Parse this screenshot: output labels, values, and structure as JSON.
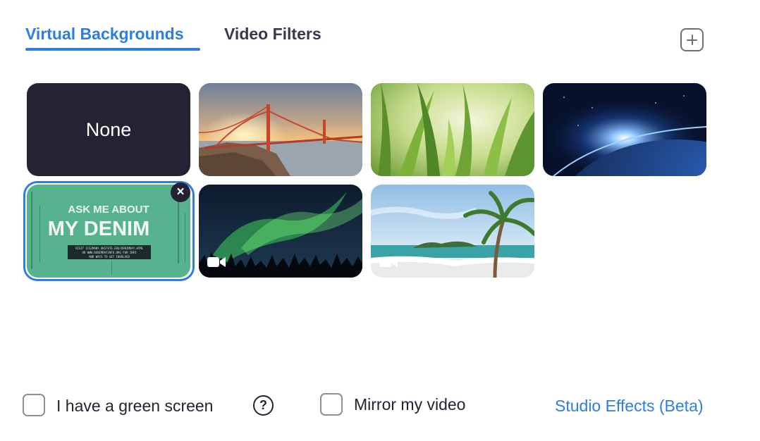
{
  "tabs": [
    {
      "label": "Virtual Backgrounds",
      "active": true
    },
    {
      "label": "Video Filters",
      "active": false
    }
  ],
  "add_icon": "plus-square-icon",
  "backgrounds": {
    "none_label": "None",
    "items": [
      "none",
      "golden-gate-bridge",
      "grass",
      "earth-from-space",
      "ask-me-about-my-denim",
      "aurora",
      "beach"
    ],
    "selected": "ask-me-about-my-denim",
    "video_badge_icon": "video-camera-icon",
    "denim": {
      "line1": "ASK ME ABOUT",
      "line2": "MY DENIM",
      "fine1": "VISIT 1IS2MANY.OKSTATE.EDU/DENIMDAY.HTML",
      "fine2": "OR WWW.DENIMDAYINFO.ORG FOR INFO",
      "fine3": "AND WAYS TO GET INVOLVED"
    },
    "remove_label": "×"
  },
  "footer": {
    "green_screen_label": "I have a green screen",
    "help_label": "?",
    "mirror_label": "Mirror my video",
    "studio_link": "Studio Effects (Beta)"
  },
  "colors": {
    "accent": "#2d7ee0",
    "dark": "#232333",
    "border": "#8e8e99"
  }
}
